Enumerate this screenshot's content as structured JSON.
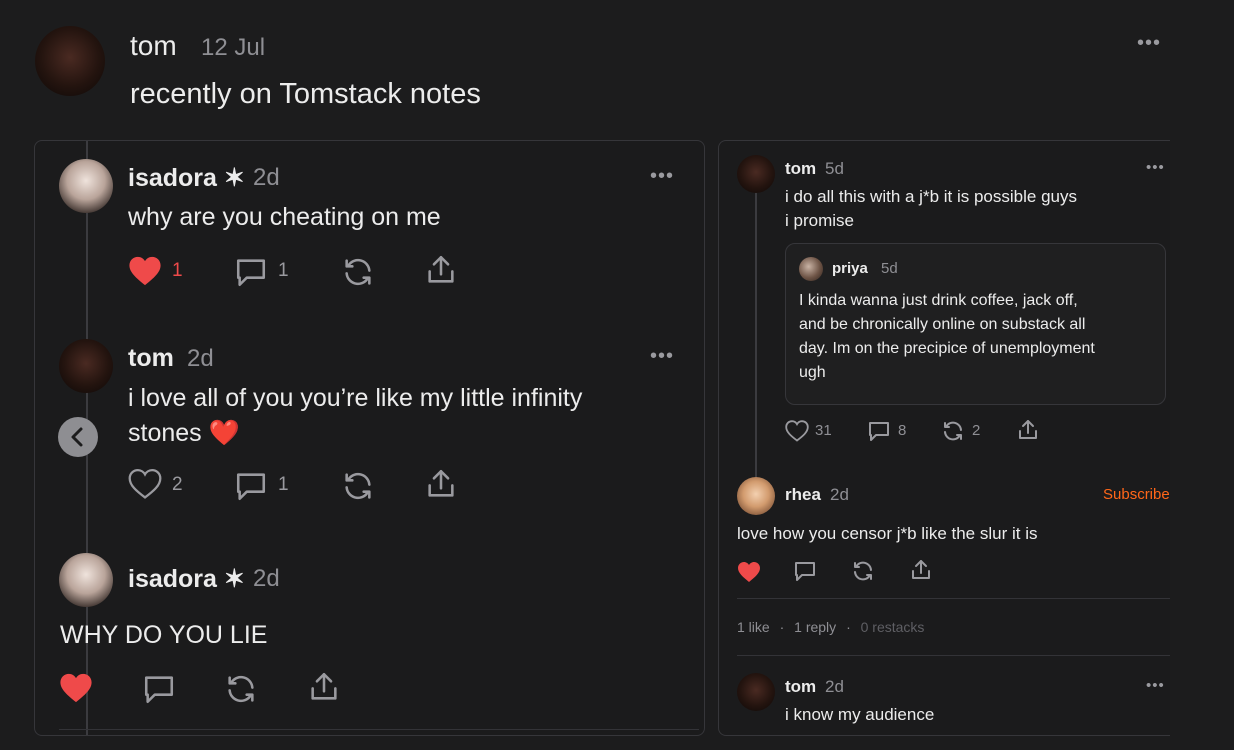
{
  "header": {
    "author": "tom",
    "date": "12 Jul",
    "body": "recently on Tomstack notes"
  },
  "left_thread": [
    {
      "author": "isadora ✶",
      "age": "2d",
      "body": "why are you cheating on me",
      "likes": "1",
      "replies": "1"
    },
    {
      "author": "tom",
      "age": "2d",
      "body_line1": "i love all of you you’re like my little infinity",
      "body_line2": "stones ❤️",
      "likes": "2",
      "replies": "1"
    },
    {
      "author": "isadora ✶",
      "age": "2d",
      "body": "WHY DO YOU LIE"
    }
  ],
  "right_thread": {
    "main": {
      "author": "tom",
      "age": "5d",
      "body_line1": "i do all this with a j*b it is possible guys",
      "body_line2": "i promise"
    },
    "quote": {
      "author": "priya",
      "age": "5d",
      "lines": [
        "I kinda wanna just drink coffee, jack off,",
        "and be chronically online on substack all",
        "day. Im on the precipice of unemployment",
        "ugh"
      ]
    },
    "main_stats": {
      "likes": "31",
      "replies": "8",
      "restacks": "2"
    },
    "reply": {
      "author": "rhea",
      "age": "2d",
      "subscribe": "Subscribe",
      "body": "love how you censor j*b like the slur it is"
    },
    "reply_meta": {
      "likes": "1 like",
      "replies": "1 reply",
      "restacks": "0 restacks",
      "sep": "·"
    },
    "last": {
      "author": "tom",
      "age": "2d",
      "body": "i know my audience"
    }
  },
  "icons": {
    "more": "more-dots-icon",
    "like": "heart-icon",
    "reply": "comment-icon",
    "restack": "restack-icon",
    "share": "share-icon",
    "back": "chevron-left-icon"
  },
  "colors": {
    "accent_like": "#ef4a4a",
    "subscribe": "#ff6719",
    "background": "#1c1c1d"
  }
}
